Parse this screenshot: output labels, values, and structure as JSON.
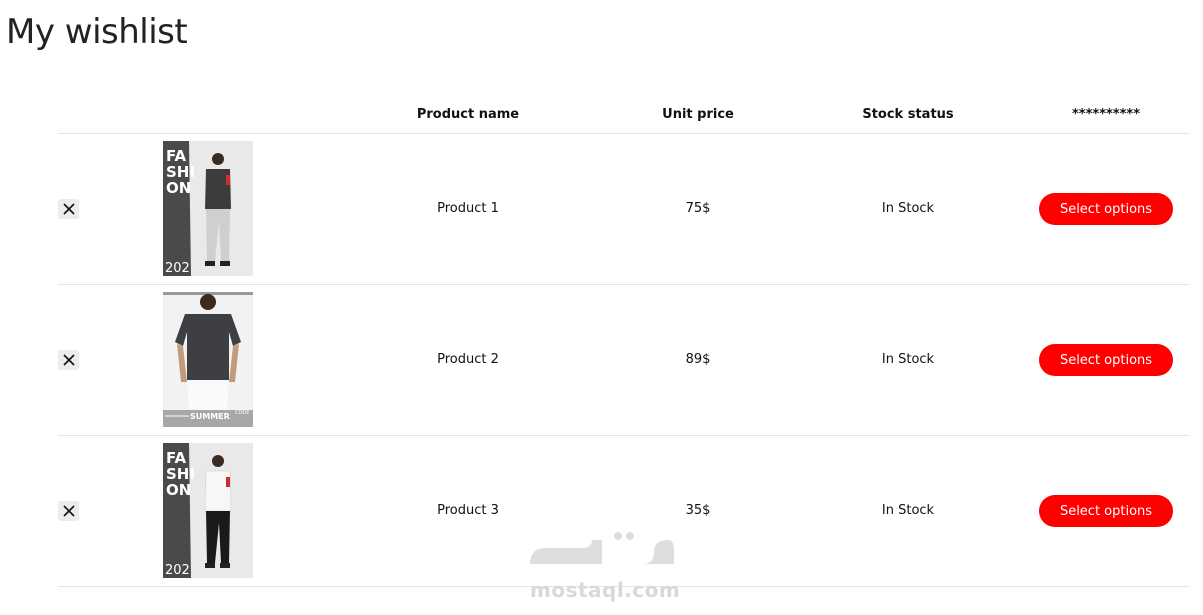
{
  "page": {
    "title": "My wishlist"
  },
  "table": {
    "headers": {
      "product_name": "Product name",
      "unit_price": "Unit price",
      "stock_status": "Stock status",
      "actions": "**********"
    },
    "rows": [
      {
        "remove_icon": "close-icon",
        "name": "Product 1",
        "price": "75$",
        "stock": "In Stock",
        "action_label": "Select options",
        "image_text": [
          "FA",
          "SHI",
          "ON",
          "202"
        ]
      },
      {
        "remove_icon": "close-icon",
        "name": "Product 2",
        "price": "89$",
        "stock": "In Stock",
        "action_label": "Select options",
        "image_text": [
          "SUMMER",
          "CODE"
        ]
      },
      {
        "remove_icon": "close-icon",
        "name": "Product 3",
        "price": "35$",
        "stock": "In Stock",
        "action_label": "Select options",
        "image_text": [
          "FA",
          "SHI",
          "ON",
          "202"
        ]
      }
    ]
  },
  "watermark": {
    "text": "mostaql.com"
  },
  "colors": {
    "accent": "#ff0000",
    "divider": "#e5e5e5"
  }
}
